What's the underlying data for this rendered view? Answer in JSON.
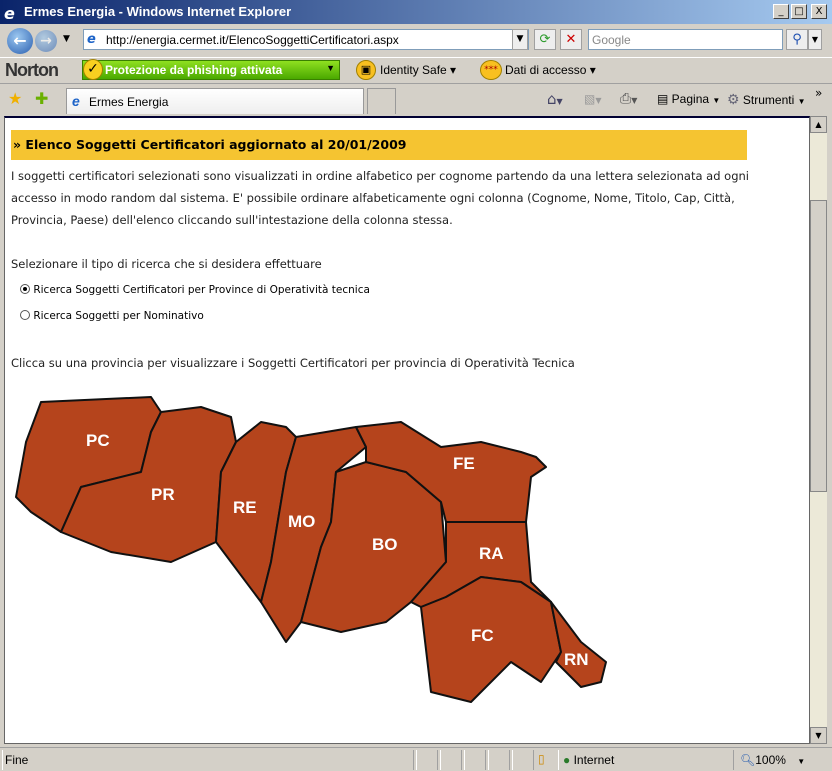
{
  "window": {
    "title": "Ermes Energia - Windows Internet Explorer",
    "min": "_",
    "max": "□",
    "close": "X"
  },
  "nav": {
    "url": "http://energia.cermet.it/ElencoSoggettiCertificatori.aspx",
    "search_placeholder": "Google"
  },
  "norton": {
    "brand": "Norton",
    "phishing": "Protezione da phishing attivata",
    "identity": "Identity Safe ▾",
    "access": "Dati di accesso ▾"
  },
  "toolbar": {
    "tab": "Ermes Energia",
    "page": "Pagina",
    "tools": "Strumenti",
    "more": "»"
  },
  "page": {
    "heading": "» Elenco Soggetti Certificatori aggiornato al 20/01/2009",
    "intro": "I soggetti certificatori selezionati sono visualizzati in ordine alfabetico per cognome partendo da una lettera selezionata ad ogni accesso in modo random dal sistema. E' possibile ordinare alfabeticamente ogni colonna (Cognome, Nome, Titolo, Cap, Città, Provincia, Paese) dell'elenco cliccando sull'intestazione della colonna stessa.",
    "select_prompt": "Selezionare il tipo di ricerca che si desidera effettuare",
    "options": [
      {
        "label": "Ricerca Soggetti Certificatori per Province di Operatività tecnica",
        "checked": true
      },
      {
        "label": "Ricerca Soggetti per Nominativo",
        "checked": false
      }
    ],
    "map_prompt": "Clicca su una provincia per visualizzare i Soggetti Certificatori per provincia di Operatività Tecnica",
    "map_color": "#b5441c",
    "provinces": [
      "PC",
      "PR",
      "RE",
      "MO",
      "BO",
      "FE",
      "RA",
      "FC",
      "RN"
    ]
  },
  "status": {
    "text": "Fine",
    "zone": "Internet",
    "zoom": "100%"
  }
}
